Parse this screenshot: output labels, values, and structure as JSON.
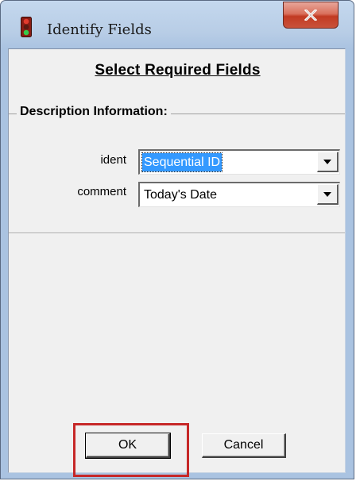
{
  "window": {
    "title": "Identify Fields",
    "close_glyph": "x",
    "app_icon": "traffic-light-icon"
  },
  "dialog": {
    "heading": "Select Required Fields",
    "group_title": "Description Information:",
    "fields": [
      {
        "label": "ident",
        "value": "Sequential ID",
        "selected": true
      },
      {
        "label": "comment",
        "value": "Today's Date",
        "selected": false
      }
    ]
  },
  "buttons": {
    "ok_label": "OK",
    "cancel_label": "Cancel"
  },
  "colors": {
    "selection": "#3399ff",
    "highlight_box": "#c62828",
    "close_button": "#c23a22"
  }
}
